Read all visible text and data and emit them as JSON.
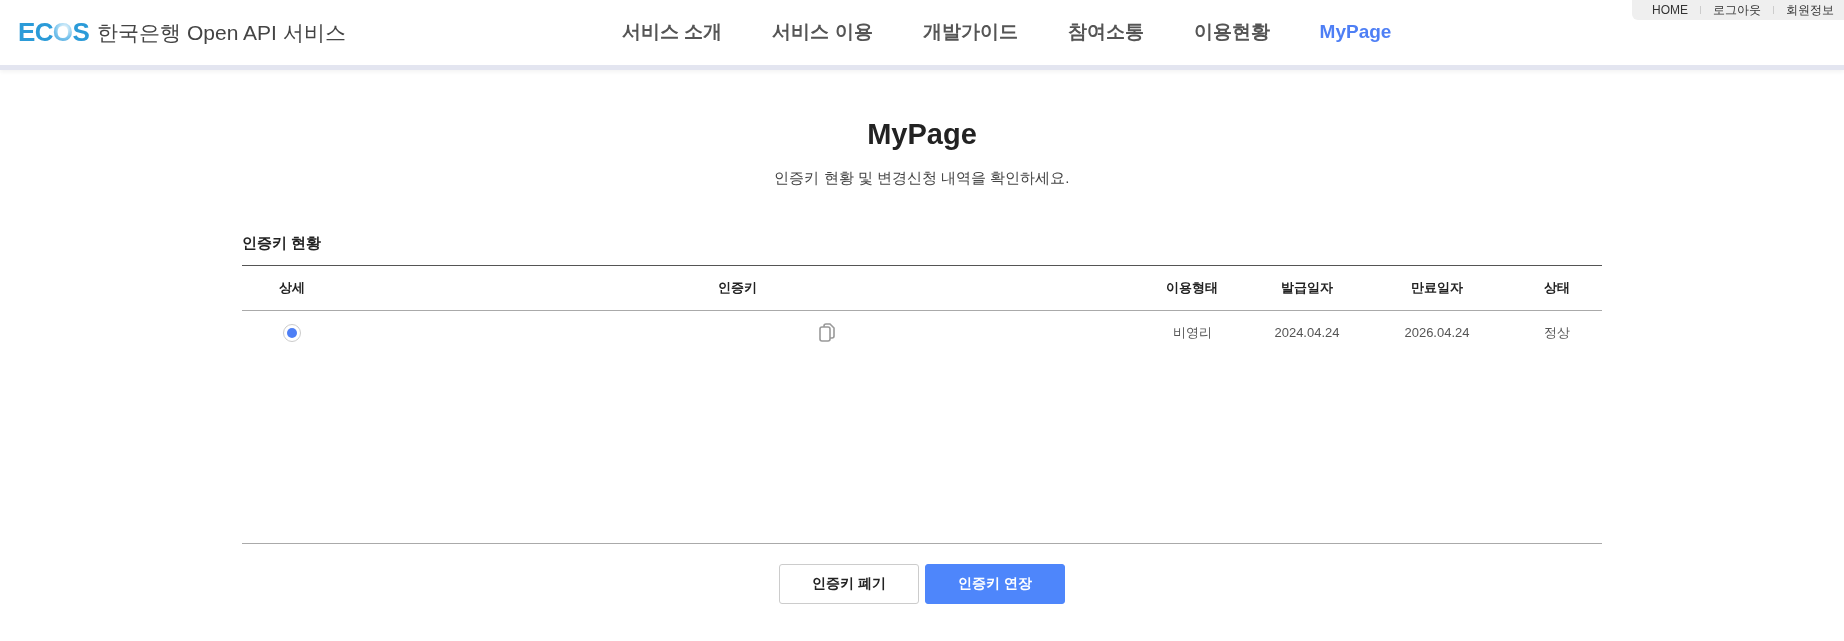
{
  "header": {
    "logo": "ECOS",
    "service_name": "한국은행 Open API 서비스",
    "nav": [
      {
        "label": "서비스 소개",
        "selected": false
      },
      {
        "label": "서비스 이용",
        "selected": false
      },
      {
        "label": "개발가이드",
        "selected": false
      },
      {
        "label": "참여소통",
        "selected": false
      },
      {
        "label": "이용현황",
        "selected": false
      },
      {
        "label": "MyPage",
        "selected": true
      }
    ],
    "utility_links": [
      "HOME",
      "로그아웃",
      "회원정보"
    ]
  },
  "page": {
    "title": "MyPage",
    "subtitle": "인증키 현황 및 변경신청 내역을 확인하세요."
  },
  "section": {
    "title": "인증키 현황",
    "table": {
      "columns": [
        "상세",
        "인증키",
        "이용형태",
        "발급일자",
        "만료일자",
        "상태"
      ],
      "rows": [
        {
          "selected": true,
          "usage_type": "비영리",
          "issued": "2024.04.24",
          "expires": "2026.04.24",
          "status": "정상"
        }
      ]
    }
  },
  "buttons": [
    {
      "label": "인증키 폐기",
      "kind": "secondary"
    },
    {
      "label": "인증키 연장",
      "kind": "primary"
    }
  ]
}
